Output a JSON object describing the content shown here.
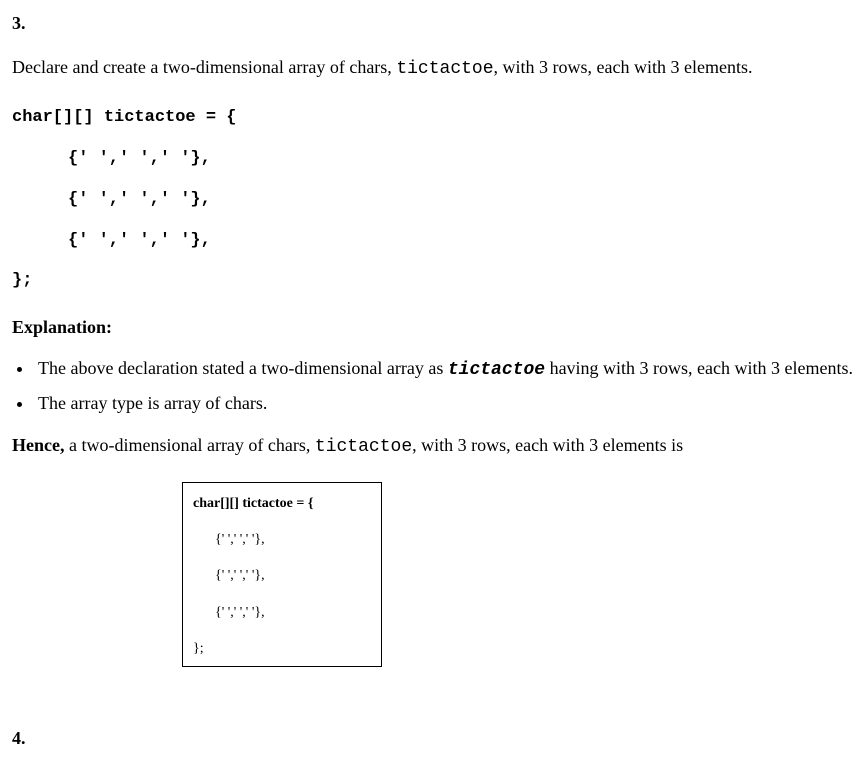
{
  "q3": {
    "number": "3.",
    "intro_pre": "Declare and create a two-dimensional array of chars, ",
    "intro_code": "tictactoe",
    "intro_post": ", with 3 rows, each with 3 elements.",
    "code": {
      "line1": "char[][] tictactoe = {",
      "row1": "{' ',' ',' '},",
      "row2": "{' ',' ',' '},",
      "row3": "{' ',' ',' '},",
      "close": "};"
    },
    "explanation_label": "Explanation:",
    "bullets": {
      "b1_pre": "The above declaration stated a two-dimensional array as ",
      "b1_code": "tictactoe",
      "b1_post": " having with 3 rows, each with 3 elements.",
      "b2": "The array type is array of chars."
    },
    "hence": {
      "bold": "Hence,",
      "pre": " a two-dimensional array of chars, ",
      "code": "tictactoe",
      "post": ", with 3 rows, each with 3 elements is"
    },
    "boxed": {
      "line1": "char[][] tictactoe = {",
      "row1": "{' ',' ',' '},",
      "row2": "{' ',' ',' '},",
      "row3": "{' ',' ',' '},",
      "close": "};"
    }
  },
  "q4": {
    "number": "4."
  }
}
